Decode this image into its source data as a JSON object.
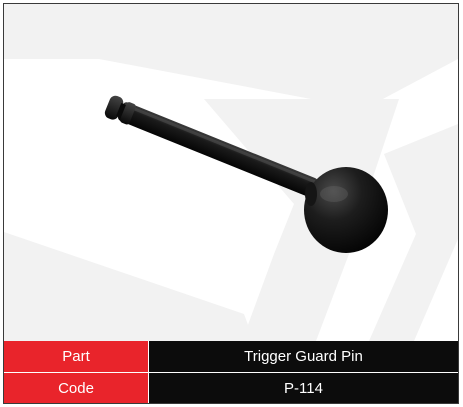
{
  "product_card": {
    "image_alt": "Black trigger guard pin with domed head",
    "specs": [
      {
        "label": "Part",
        "value": "Trigger Guard Pin"
      },
      {
        "label": "Code",
        "value": "P-114"
      }
    ]
  },
  "colors": {
    "label_background": "#e9242b",
    "value_background": "#0c0c0c",
    "text": "#ffffff",
    "watermark": "#f2f2f2"
  }
}
